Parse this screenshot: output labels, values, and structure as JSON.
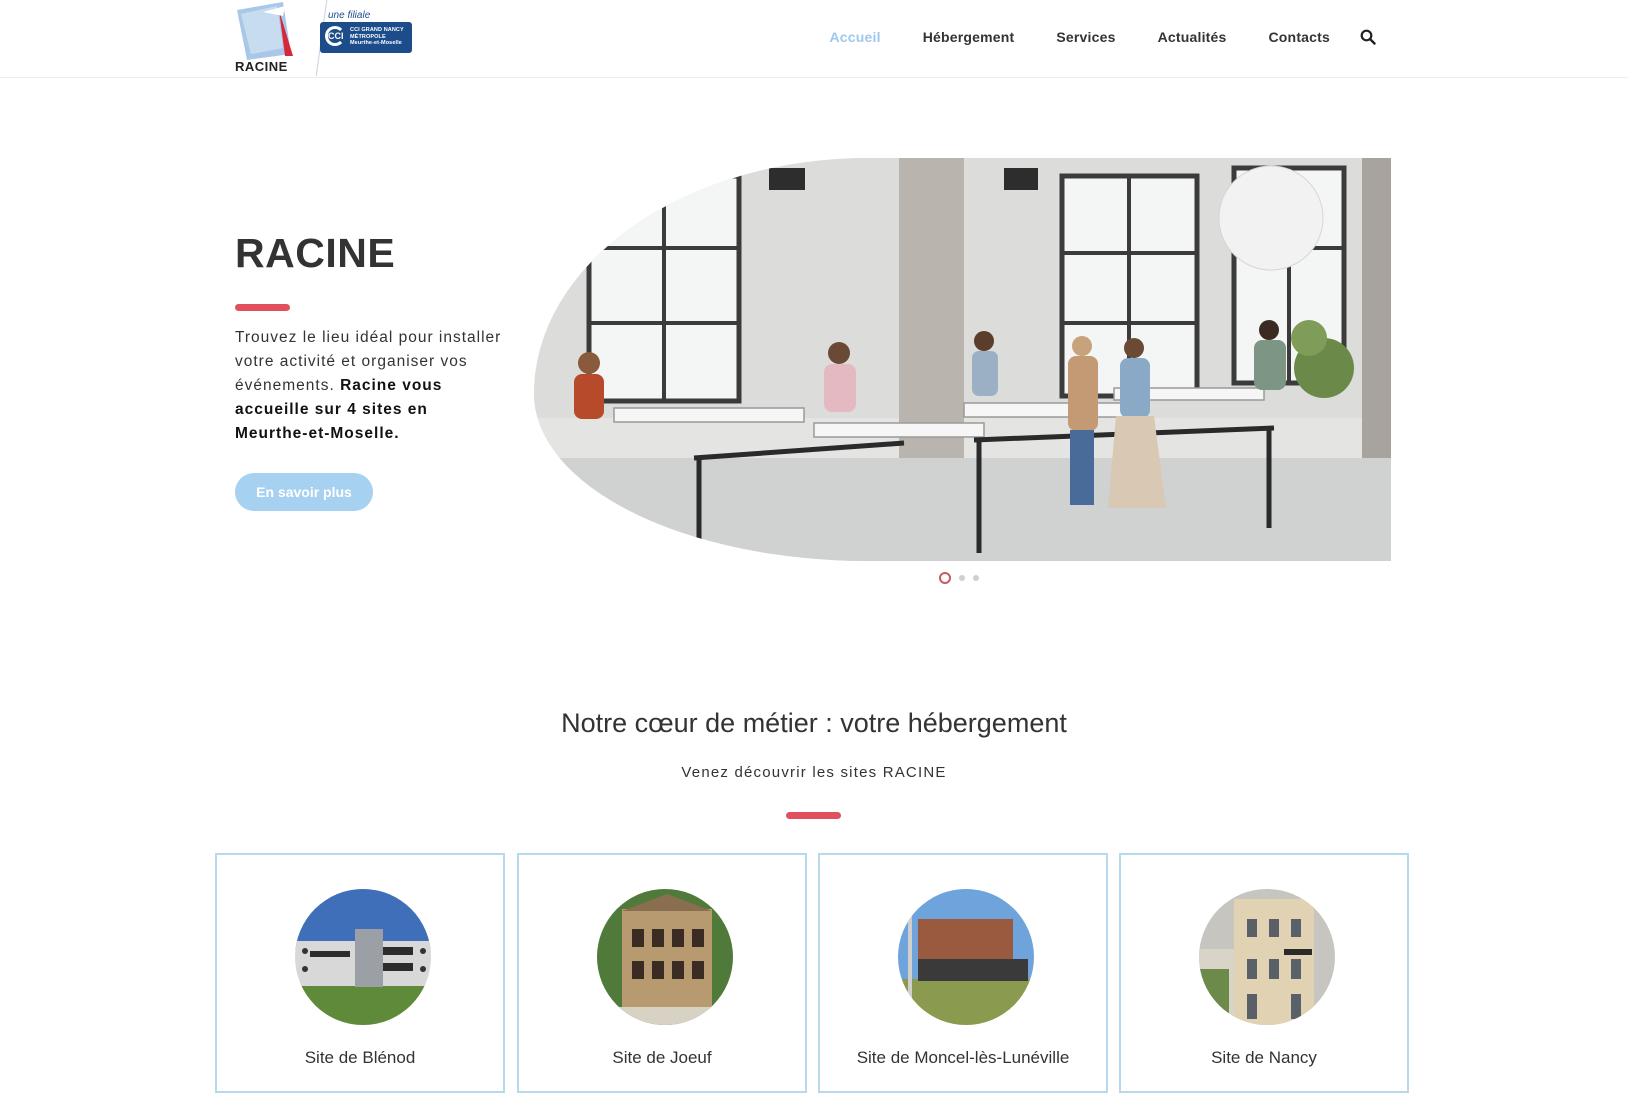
{
  "header": {
    "logo_text": "RACINE",
    "filiale_text": "une filiale",
    "cci_symbol": "CCI",
    "cci_lines": [
      "CCI GRAND NANCY",
      "MÉTROPOLE",
      "Meurthe-et-Moselle"
    ],
    "nav": [
      {
        "label": "Accueil",
        "active": true
      },
      {
        "label": "Hébergement",
        "active": false
      },
      {
        "label": "Services",
        "active": false
      },
      {
        "label": "Actualités",
        "active": false
      },
      {
        "label": "Contacts",
        "active": false
      }
    ]
  },
  "hero": {
    "title": "RACINE",
    "text_regular": "Trouvez le lieu idéal pour installer votre activité et organiser vos événements.",
    "text_bold": "Racine vous accueille sur 4 sites en Meurthe-et-Moselle.",
    "cta_label": "En savoir plus",
    "slide_count": 3,
    "active_slide": 1
  },
  "section": {
    "title": "Notre cœur de métier : votre hébergement",
    "subtitle": "Venez découvrir les sites RACINE"
  },
  "sites": [
    {
      "name": "Site de Blénod"
    },
    {
      "name": "Site de Joeuf"
    },
    {
      "name": "Site de Moncel-lès-Lunéville"
    },
    {
      "name": "Site de Nancy"
    }
  ],
  "colors": {
    "accent_blue": "#9fc9ea",
    "accent_red": "#e0505f",
    "card_border": "#b7d9ec",
    "cci_blue": "#1c4d8a"
  },
  "icons": {
    "search": "search-icon"
  }
}
